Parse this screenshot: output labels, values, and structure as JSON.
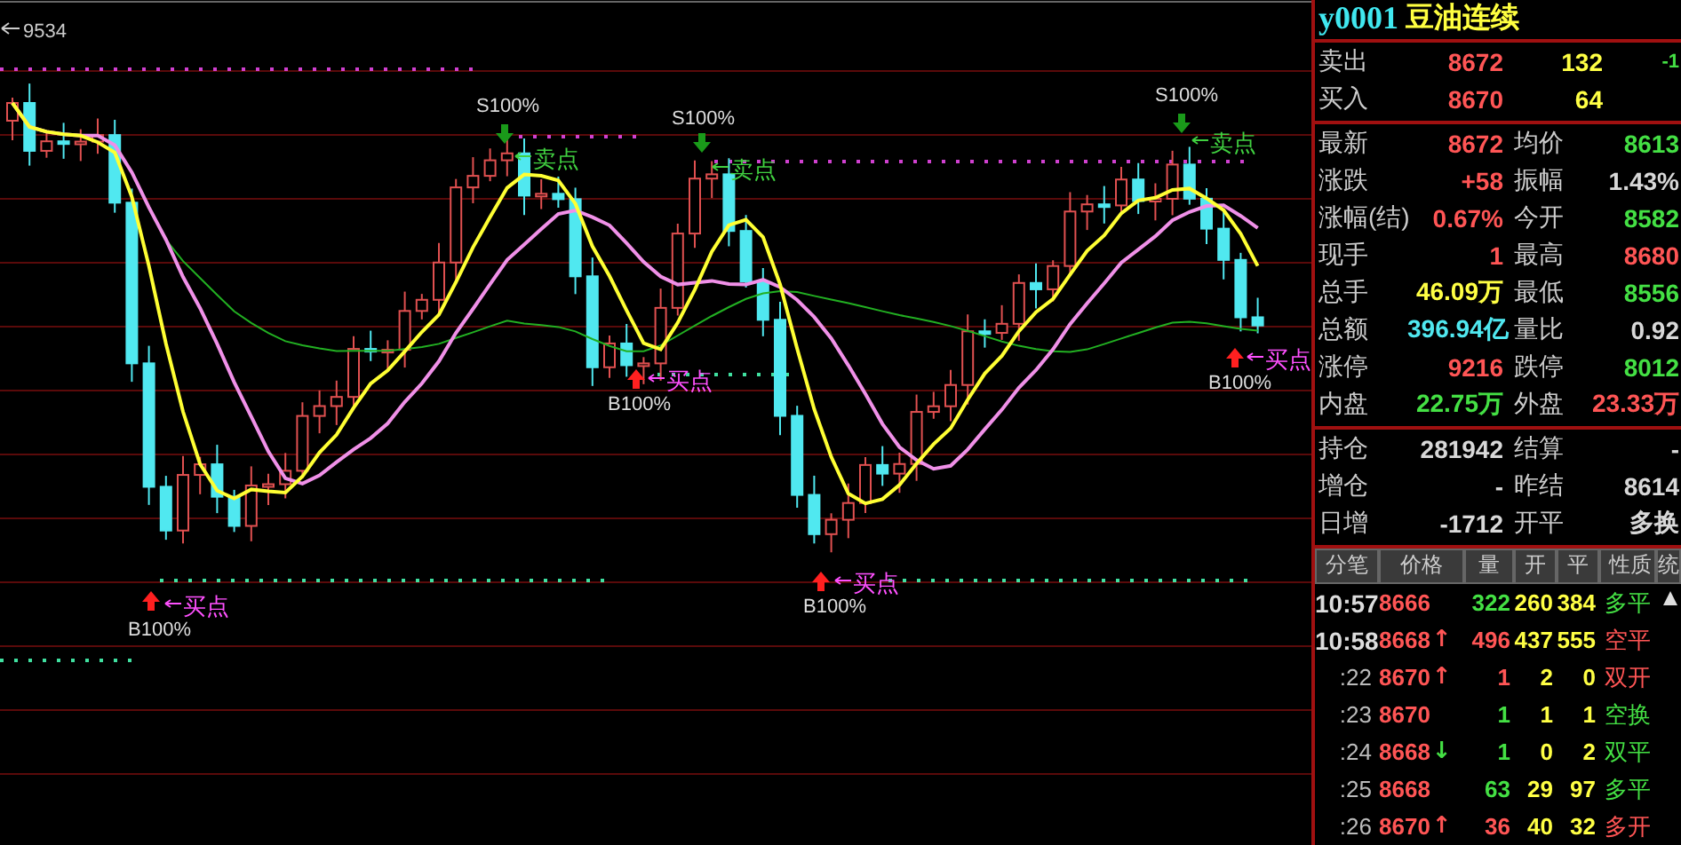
{
  "chart": {
    "high_label": "9534",
    "signals": [
      {
        "kind": "buy",
        "percent": "B100%",
        "point": "买点"
      },
      {
        "kind": "sell",
        "percent": "S100%",
        "point": "卖点"
      },
      {
        "kind": "buy",
        "percent": "B100%",
        "point": "买点"
      },
      {
        "kind": "sell",
        "percent": "S100%",
        "point": "卖点"
      },
      {
        "kind": "buy",
        "percent": "B100%",
        "point": "买点"
      },
      {
        "kind": "sell",
        "percent": "S100%",
        "point": "卖点"
      },
      {
        "kind": "buy",
        "percent": "B100%",
        "point": "买点"
      }
    ]
  },
  "quote": {
    "symbol": "y0001",
    "name": "豆油连续"
  },
  "order_book": [
    {
      "label": "卖出",
      "price": "8672",
      "volume": "132",
      "change": "-1"
    },
    {
      "label": "买入",
      "price": "8670",
      "volume": "64"
    }
  ],
  "stats": [
    {
      "left": {
        "label": "最新",
        "value": "8672",
        "color": "#ff5555"
      },
      "right": {
        "label": "均价",
        "value": "8613",
        "color": "#44e044"
      }
    },
    {
      "left": {
        "label": "涨跌",
        "value": "+58",
        "color": "#ff5555"
      },
      "right": {
        "label": "振幅",
        "value": "1.43%",
        "color": "#d8d8d8"
      }
    },
    {
      "left": {
        "label": "涨幅(结)",
        "value": "0.67%",
        "color": "#ff5555"
      },
      "right": {
        "label": "今开",
        "value": "8582",
        "color": "#44e044"
      }
    },
    {
      "left": {
        "label": "现手",
        "value": "1",
        "color": "#ff5555"
      },
      "right": {
        "label": "最高",
        "value": "8680",
        "color": "#ff5555"
      }
    },
    {
      "left": {
        "label": "总手",
        "value": "46.09万",
        "color": "#ffff44"
      },
      "right": {
        "label": "最低",
        "value": "8556",
        "color": "#44e044"
      }
    },
    {
      "left": {
        "label": "总额",
        "value": "396.94亿",
        "color": "#50e8f0"
      },
      "right": {
        "label": "量比",
        "value": "0.92",
        "color": "#d8d8d8"
      }
    },
    {
      "left": {
        "label": "涨停",
        "value": "9216",
        "color": "#ff5555"
      },
      "right": {
        "label": "跌停",
        "value": "8012",
        "color": "#44e044"
      }
    },
    {
      "left": {
        "label": "内盘",
        "value": "22.75万",
        "color": "#44e044"
      },
      "right": {
        "label": "外盘",
        "value": "23.33万",
        "color": "#ff5555"
      }
    }
  ],
  "position_stats": [
    {
      "left": {
        "label": "持仓",
        "value": "281942"
      },
      "right": {
        "label": "结算",
        "value": "-"
      }
    },
    {
      "left": {
        "label": "增仓",
        "value": "-"
      },
      "right": {
        "label": "昨结",
        "value": "8614"
      }
    },
    {
      "left": {
        "label": "日增",
        "value": "-1712"
      },
      "right": {
        "label": "开平",
        "value": "多换"
      }
    }
  ],
  "ticks": {
    "columns": [
      "分笔",
      "价格",
      "量",
      "开",
      "平",
      "性质",
      "统"
    ],
    "rows": [
      {
        "kind": "full",
        "time": "10:57",
        "price": "8666",
        "volume": "322",
        "open": "260",
        "close": "384",
        "nature": "多平",
        "color": "#44e044"
      },
      {
        "kind": "full",
        "time": "10:58",
        "price": "8668",
        "arrow": "↑",
        "volume": "496",
        "open": "437",
        "close": "555",
        "nature": "空平",
        "color": "#ff5555"
      },
      {
        "kind": "short",
        "time": ":22",
        "price": "8670",
        "arrow": "↑",
        "volume": "1",
        "open": "2",
        "close": "0",
        "nature": "双开",
        "color": "#ff5555"
      },
      {
        "kind": "short",
        "time": ":23",
        "price": "8670",
        "volume": "1",
        "open": "1",
        "close": "1",
        "nature": "空换",
        "color": "#44e044"
      },
      {
        "kind": "short",
        "time": ":24",
        "price": "8668",
        "arrow": "↓",
        "volume": "1",
        "open": "0",
        "close": "2",
        "nature": "双平",
        "color": "#44e044"
      },
      {
        "kind": "short",
        "time": ":25",
        "price": "8668",
        "volume": "63",
        "open": "29",
        "close": "97",
        "nature": "多平",
        "color": "#44e044"
      },
      {
        "kind": "short",
        "time": ":26",
        "price": "8670",
        "arrow": "↑",
        "volume": "36",
        "open": "40",
        "close": "32",
        "nature": "多开",
        "color": "#ff5555"
      }
    ]
  }
}
